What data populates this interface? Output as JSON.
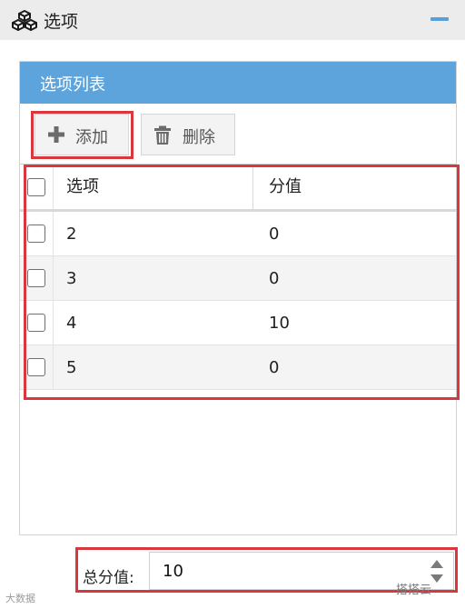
{
  "header": {
    "title": "选项",
    "icon": "cubes-icon",
    "collapse_icon": "minus-icon"
  },
  "panel": {
    "title": "选项列表",
    "toolbar": {
      "add_label": "添加",
      "delete_label": "删除"
    },
    "table": {
      "columns": [
        "选项",
        "分值"
      ],
      "rows": [
        {
          "option": "2",
          "score": "0"
        },
        {
          "option": "3",
          "score": "0"
        },
        {
          "option": "4",
          "score": "10"
        },
        {
          "option": "5",
          "score": "0"
        }
      ]
    }
  },
  "total": {
    "label": "总分值:",
    "value": "10"
  },
  "watermarks": {
    "left": "大数据",
    "right": "搭搭云"
  },
  "colors": {
    "accent": "#5ea4dc",
    "highlight": "#d9373e"
  }
}
